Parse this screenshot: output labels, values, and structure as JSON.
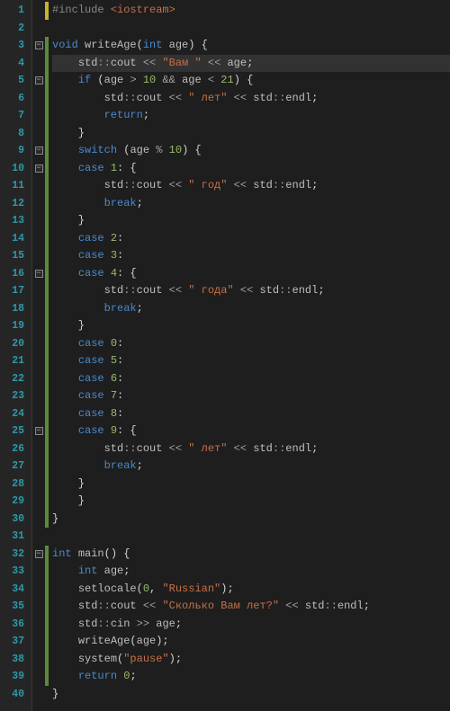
{
  "colors": {
    "background": "#1e1e1e",
    "gutter_bg": "#252526",
    "line_number": "#2b9aa8",
    "keyword": "#4a8acc",
    "string": "#c4714a",
    "number": "#9aba6a",
    "preprocessor": "#888888",
    "identifier": "#bfbfbf",
    "change_bar_yellow": "#c8b030",
    "change_bar_green": "#5a8a3a",
    "highlight_line_bg": "#323232"
  },
  "highlighted_line": 4,
  "lines": [
    {
      "n": 1,
      "bar": "yellow",
      "fold": "",
      "tokens": [
        [
          "pp",
          "#include "
        ],
        [
          "str",
          "<iostream>"
        ]
      ]
    },
    {
      "n": 2,
      "bar": "",
      "fold": "",
      "tokens": []
    },
    {
      "n": 3,
      "bar": "green",
      "fold": "minus",
      "tokens": [
        [
          "kw",
          "void "
        ],
        [
          "fn",
          "writeAge"
        ],
        [
          "pun",
          "("
        ],
        [
          "typ",
          "int "
        ],
        [
          "id",
          "age"
        ],
        [
          "pun",
          ") {"
        ]
      ]
    },
    {
      "n": 4,
      "bar": "green",
      "fold": "",
      "tokens": [
        [
          "pun",
          "    "
        ],
        [
          "ns",
          "std"
        ],
        [
          "op",
          "::"
        ],
        [
          "id",
          "cout "
        ],
        [
          "op",
          "<< "
        ],
        [
          "str",
          "\"Вам \""
        ],
        [
          "op",
          " << "
        ],
        [
          "id",
          "age"
        ],
        [
          "pun",
          ";"
        ]
      ]
    },
    {
      "n": 5,
      "bar": "green",
      "fold": "minus",
      "tokens": [
        [
          "pun",
          "    "
        ],
        [
          "kw",
          "if "
        ],
        [
          "pun",
          "("
        ],
        [
          "id",
          "age "
        ],
        [
          "op",
          "> "
        ],
        [
          "num",
          "10"
        ],
        [
          "op",
          " && "
        ],
        [
          "id",
          "age "
        ],
        [
          "op",
          "< "
        ],
        [
          "num",
          "21"
        ],
        [
          "pun",
          ") {"
        ]
      ]
    },
    {
      "n": 6,
      "bar": "green",
      "fold": "",
      "tokens": [
        [
          "pun",
          "        "
        ],
        [
          "ns",
          "std"
        ],
        [
          "op",
          "::"
        ],
        [
          "id",
          "cout "
        ],
        [
          "op",
          "<< "
        ],
        [
          "str",
          "\" лет\""
        ],
        [
          "op",
          " << "
        ],
        [
          "ns",
          "std"
        ],
        [
          "op",
          "::"
        ],
        [
          "id",
          "endl"
        ],
        [
          "pun",
          ";"
        ]
      ]
    },
    {
      "n": 7,
      "bar": "green",
      "fold": "",
      "tokens": [
        [
          "pun",
          "        "
        ],
        [
          "kw",
          "return"
        ],
        [
          "pun",
          ";"
        ]
      ]
    },
    {
      "n": 8,
      "bar": "green",
      "fold": "",
      "tokens": [
        [
          "pun",
          "    }"
        ]
      ]
    },
    {
      "n": 9,
      "bar": "green",
      "fold": "minus",
      "tokens": [
        [
          "pun",
          "    "
        ],
        [
          "kw",
          "switch "
        ],
        [
          "pun",
          "("
        ],
        [
          "id",
          "age "
        ],
        [
          "op",
          "% "
        ],
        [
          "num",
          "10"
        ],
        [
          "pun",
          ") {"
        ]
      ]
    },
    {
      "n": 10,
      "bar": "green",
      "fold": "minus",
      "tokens": [
        [
          "pun",
          "    "
        ],
        [
          "kw",
          "case "
        ],
        [
          "num",
          "1"
        ],
        [
          "pun",
          ": {"
        ]
      ]
    },
    {
      "n": 11,
      "bar": "green",
      "fold": "",
      "tokens": [
        [
          "pun",
          "        "
        ],
        [
          "ns",
          "std"
        ],
        [
          "op",
          "::"
        ],
        [
          "id",
          "cout "
        ],
        [
          "op",
          "<< "
        ],
        [
          "str",
          "\" год\""
        ],
        [
          "op",
          " << "
        ],
        [
          "ns",
          "std"
        ],
        [
          "op",
          "::"
        ],
        [
          "id",
          "endl"
        ],
        [
          "pun",
          ";"
        ]
      ]
    },
    {
      "n": 12,
      "bar": "green",
      "fold": "",
      "tokens": [
        [
          "pun",
          "        "
        ],
        [
          "kw",
          "break"
        ],
        [
          "pun",
          ";"
        ]
      ]
    },
    {
      "n": 13,
      "bar": "green",
      "fold": "",
      "tokens": [
        [
          "pun",
          "    }"
        ]
      ]
    },
    {
      "n": 14,
      "bar": "green",
      "fold": "",
      "tokens": [
        [
          "pun",
          "    "
        ],
        [
          "kw",
          "case "
        ],
        [
          "num",
          "2"
        ],
        [
          "pun",
          ":"
        ]
      ]
    },
    {
      "n": 15,
      "bar": "green",
      "fold": "",
      "tokens": [
        [
          "pun",
          "    "
        ],
        [
          "kw",
          "case "
        ],
        [
          "num",
          "3"
        ],
        [
          "pun",
          ":"
        ]
      ]
    },
    {
      "n": 16,
      "bar": "green",
      "fold": "minus",
      "tokens": [
        [
          "pun",
          "    "
        ],
        [
          "kw",
          "case "
        ],
        [
          "num",
          "4"
        ],
        [
          "pun",
          ": {"
        ]
      ]
    },
    {
      "n": 17,
      "bar": "green",
      "fold": "",
      "tokens": [
        [
          "pun",
          "        "
        ],
        [
          "ns",
          "std"
        ],
        [
          "op",
          "::"
        ],
        [
          "id",
          "cout "
        ],
        [
          "op",
          "<< "
        ],
        [
          "str",
          "\" года\""
        ],
        [
          "op",
          " << "
        ],
        [
          "ns",
          "std"
        ],
        [
          "op",
          "::"
        ],
        [
          "id",
          "endl"
        ],
        [
          "pun",
          ";"
        ]
      ]
    },
    {
      "n": 18,
      "bar": "green",
      "fold": "",
      "tokens": [
        [
          "pun",
          "        "
        ],
        [
          "kw",
          "break"
        ],
        [
          "pun",
          ";"
        ]
      ]
    },
    {
      "n": 19,
      "bar": "green",
      "fold": "",
      "tokens": [
        [
          "pun",
          "    }"
        ]
      ]
    },
    {
      "n": 20,
      "bar": "green",
      "fold": "",
      "tokens": [
        [
          "pun",
          "    "
        ],
        [
          "kw",
          "case "
        ],
        [
          "num",
          "0"
        ],
        [
          "pun",
          ":"
        ]
      ]
    },
    {
      "n": 21,
      "bar": "green",
      "fold": "",
      "tokens": [
        [
          "pun",
          "    "
        ],
        [
          "kw",
          "case "
        ],
        [
          "num",
          "5"
        ],
        [
          "pun",
          ":"
        ]
      ]
    },
    {
      "n": 22,
      "bar": "green",
      "fold": "",
      "tokens": [
        [
          "pun",
          "    "
        ],
        [
          "kw",
          "case "
        ],
        [
          "num",
          "6"
        ],
        [
          "pun",
          ":"
        ]
      ]
    },
    {
      "n": 23,
      "bar": "green",
      "fold": "",
      "tokens": [
        [
          "pun",
          "    "
        ],
        [
          "kw",
          "case "
        ],
        [
          "num",
          "7"
        ],
        [
          "pun",
          ":"
        ]
      ]
    },
    {
      "n": 24,
      "bar": "green",
      "fold": "",
      "tokens": [
        [
          "pun",
          "    "
        ],
        [
          "kw",
          "case "
        ],
        [
          "num",
          "8"
        ],
        [
          "pun",
          ":"
        ]
      ]
    },
    {
      "n": 25,
      "bar": "green",
      "fold": "minus",
      "tokens": [
        [
          "pun",
          "    "
        ],
        [
          "kw",
          "case "
        ],
        [
          "num",
          "9"
        ],
        [
          "pun",
          ": {"
        ]
      ]
    },
    {
      "n": 26,
      "bar": "green",
      "fold": "",
      "tokens": [
        [
          "pun",
          "        "
        ],
        [
          "ns",
          "std"
        ],
        [
          "op",
          "::"
        ],
        [
          "id",
          "cout "
        ],
        [
          "op",
          "<< "
        ],
        [
          "str",
          "\" лет\""
        ],
        [
          "op",
          " << "
        ],
        [
          "ns",
          "std"
        ],
        [
          "op",
          "::"
        ],
        [
          "id",
          "endl"
        ],
        [
          "pun",
          ";"
        ]
      ]
    },
    {
      "n": 27,
      "bar": "green",
      "fold": "",
      "tokens": [
        [
          "pun",
          "        "
        ],
        [
          "kw",
          "break"
        ],
        [
          "pun",
          ";"
        ]
      ]
    },
    {
      "n": 28,
      "bar": "green",
      "fold": "",
      "tokens": [
        [
          "pun",
          "    }"
        ]
      ]
    },
    {
      "n": 29,
      "bar": "green",
      "fold": "",
      "tokens": [
        [
          "pun",
          "    }"
        ]
      ]
    },
    {
      "n": 30,
      "bar": "green",
      "fold": "",
      "tokens": [
        [
          "pun",
          "}"
        ]
      ]
    },
    {
      "n": 31,
      "bar": "",
      "fold": "",
      "tokens": []
    },
    {
      "n": 32,
      "bar": "green",
      "fold": "minus",
      "tokens": [
        [
          "typ",
          "int "
        ],
        [
          "fn",
          "main"
        ],
        [
          "pun",
          "() {"
        ]
      ]
    },
    {
      "n": 33,
      "bar": "green",
      "fold": "",
      "tokens": [
        [
          "pun",
          "    "
        ],
        [
          "typ",
          "int "
        ],
        [
          "id",
          "age"
        ],
        [
          "pun",
          ";"
        ]
      ]
    },
    {
      "n": 34,
      "bar": "green",
      "fold": "",
      "tokens": [
        [
          "pun",
          "    "
        ],
        [
          "fn",
          "setlocale"
        ],
        [
          "pun",
          "("
        ],
        [
          "num",
          "0"
        ],
        [
          "pun",
          ", "
        ],
        [
          "str",
          "\"Russian\""
        ],
        [
          "pun",
          ");"
        ]
      ]
    },
    {
      "n": 35,
      "bar": "green",
      "fold": "",
      "tokens": [
        [
          "pun",
          "    "
        ],
        [
          "ns",
          "std"
        ],
        [
          "op",
          "::"
        ],
        [
          "id",
          "cout "
        ],
        [
          "op",
          "<< "
        ],
        [
          "str",
          "\"Сколько Вам лет?\""
        ],
        [
          "op",
          " << "
        ],
        [
          "ns",
          "std"
        ],
        [
          "op",
          "::"
        ],
        [
          "id",
          "endl"
        ],
        [
          "pun",
          ";"
        ]
      ]
    },
    {
      "n": 36,
      "bar": "green",
      "fold": "",
      "tokens": [
        [
          "pun",
          "    "
        ],
        [
          "ns",
          "std"
        ],
        [
          "op",
          "::"
        ],
        [
          "id",
          "cin "
        ],
        [
          "op",
          ">> "
        ],
        [
          "id",
          "age"
        ],
        [
          "pun",
          ";"
        ]
      ]
    },
    {
      "n": 37,
      "bar": "green",
      "fold": "",
      "tokens": [
        [
          "pun",
          "    "
        ],
        [
          "fn",
          "writeAge"
        ],
        [
          "pun",
          "("
        ],
        [
          "id",
          "age"
        ],
        [
          "pun",
          ");"
        ]
      ]
    },
    {
      "n": 38,
      "bar": "green",
      "fold": "",
      "tokens": [
        [
          "pun",
          "    "
        ],
        [
          "fn",
          "system"
        ],
        [
          "pun",
          "("
        ],
        [
          "str",
          "\"pause\""
        ],
        [
          "pun",
          ");"
        ]
      ]
    },
    {
      "n": 39,
      "bar": "green",
      "fold": "",
      "tokens": [
        [
          "pun",
          "    "
        ],
        [
          "kw",
          "return "
        ],
        [
          "num",
          "0"
        ],
        [
          "pun",
          ";"
        ]
      ]
    },
    {
      "n": 40,
      "bar": "",
      "fold": "",
      "tokens": [
        [
          "pun",
          "}"
        ]
      ]
    }
  ]
}
